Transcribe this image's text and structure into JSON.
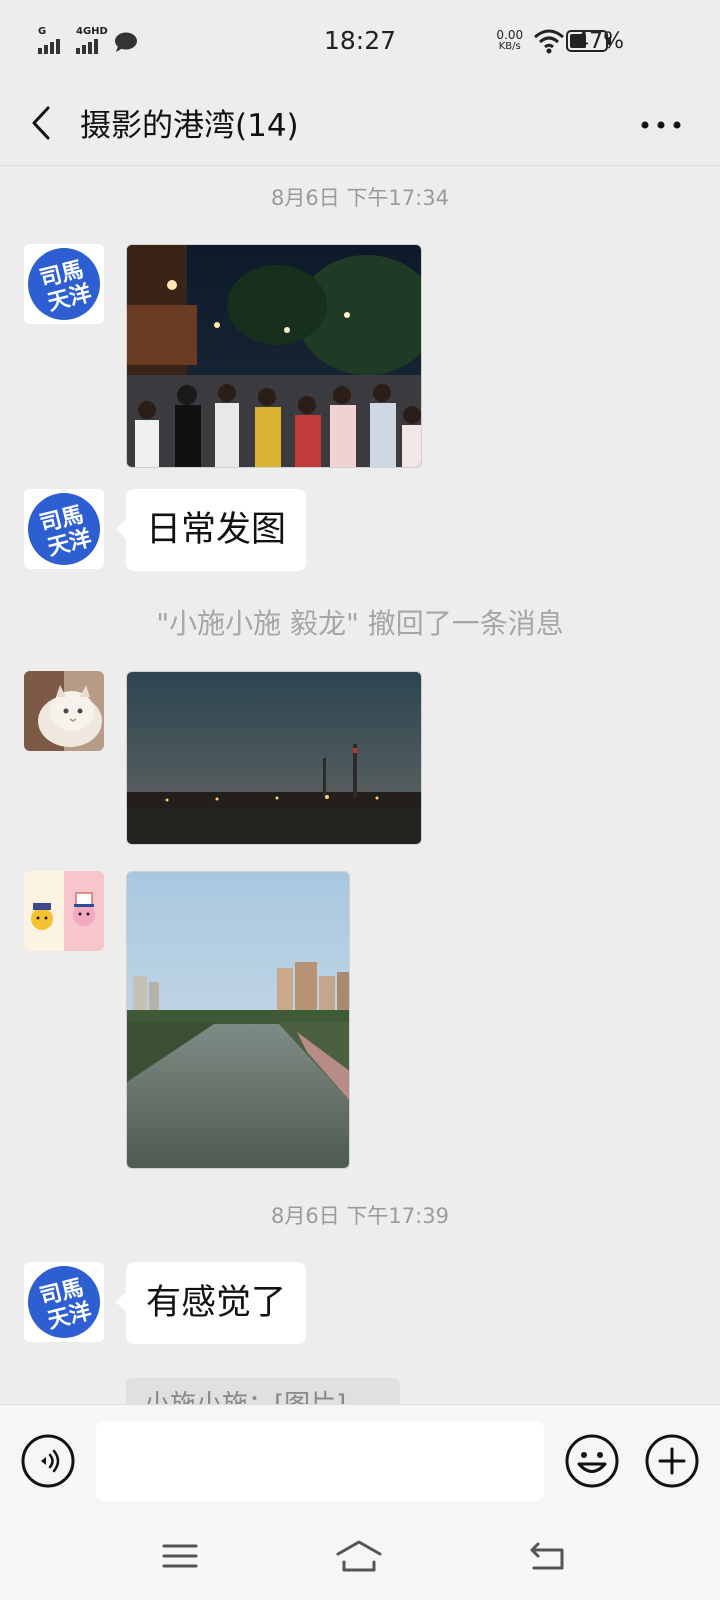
{
  "status_bar": {
    "sim1_label": "G",
    "sim2_label": "4GHD",
    "time": "18:27",
    "speed_value": "0.00",
    "speed_unit": "KB/s",
    "battery_percent": "47%",
    "battery_level": 0.47
  },
  "header": {
    "title": "摄影的港湾(14)"
  },
  "messages": {
    "time1": "8月6日 下午17:34",
    "text1": "日常发图",
    "recall_notice": "\"小施小施 毅龙\" 撤回了一条消息",
    "time2": "8月6日 下午17:39",
    "text2": "有感觉了",
    "quote_partial": "小施小施：[图片]"
  },
  "avatars": {
    "logo_text_top": "司馬",
    "logo_text_bottom": "天洋"
  },
  "input": {
    "placeholder": ""
  },
  "colors": {
    "background": "#ededed",
    "logo_blue": "#2d5fd3",
    "bubble": "#ffffff"
  }
}
